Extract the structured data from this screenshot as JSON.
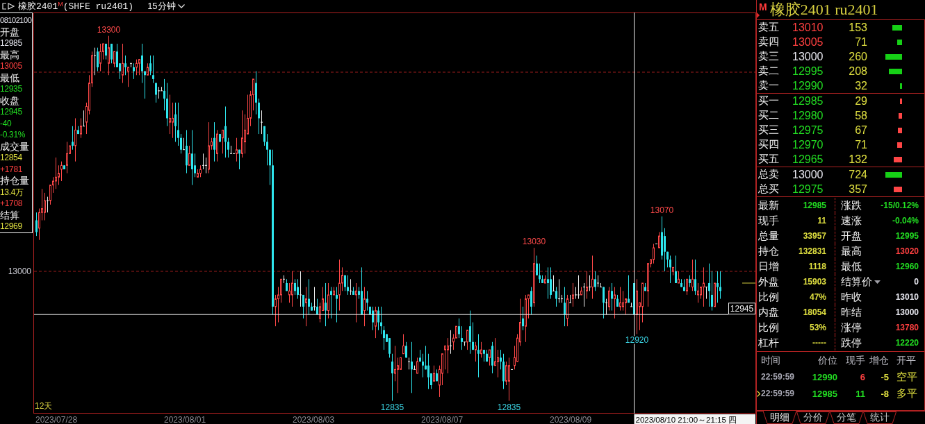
{
  "title_bar": {
    "title": "橡胶2401$^{M}$(SHFE ru2401)",
    "period": "15分钟"
  },
  "info_panel": {
    "time": "08102100",
    "fields": [
      {
        "label": "开盘",
        "values": [
          {
            "text": "12985",
            "color": "#e8e8f0"
          }
        ]
      },
      {
        "label": "最高",
        "values": [
          {
            "text": "13005",
            "color": "#ff4040"
          }
        ]
      },
      {
        "label": "最低",
        "values": [
          {
            "text": "12935",
            "color": "#22dd22"
          }
        ]
      },
      {
        "label": "收盘",
        "values": [
          {
            "text": "12945",
            "color": "#22dd22"
          },
          {
            "text": "-40",
            "color": "#22dd22"
          },
          {
            "text": "-0.31%",
            "color": "#22dd22"
          }
        ]
      },
      {
        "label": "成交量",
        "values": [
          {
            "text": "12854",
            "color": "#e0e040"
          },
          {
            "text": "+1781",
            "color": "#ff4040"
          }
        ]
      },
      {
        "label": "持仓量",
        "values": [
          {
            "text": "13.4万",
            "color": "#e0e040"
          },
          {
            "text": "+1708",
            "color": "#ff4040"
          }
        ]
      },
      {
        "label": "结算",
        "values": [
          {
            "text": "12969",
            "color": "#e0e040"
          }
        ]
      }
    ]
  },
  "chart": {
    "y_axis_label": "13000",
    "annotations": [
      {
        "text": "13300",
        "kind": "high"
      },
      {
        "text": "12835",
        "kind": "low"
      },
      {
        "text": "12835",
        "kind": "low"
      },
      {
        "text": "13030",
        "kind": "high"
      },
      {
        "text": "12920",
        "kind": "low"
      },
      {
        "text": "13070",
        "kind": "high"
      }
    ],
    "crosshair_price": "12945",
    "range_label": "12天",
    "x_axis_labels": [
      "2023/07/28",
      "2023/08/01",
      "2023/08/03",
      "2023/08/07",
      "2023/08/09"
    ],
    "crosshair_time": "2023/08/10 21:00～21:15 四"
  },
  "quote_header": {
    "badge": "M",
    "title": "橡胶2401 ru2401"
  },
  "order_book": {
    "asks": [
      {
        "label": "卖五",
        "price": {
          "text": "13010",
          "color": "#ff4040"
        },
        "quantity": "153",
        "color": "#16d016"
      },
      {
        "label": "卖四",
        "price": {
          "text": "13005",
          "color": "#ff4040"
        },
        "quantity": "71",
        "color": "#16d016"
      },
      {
        "label": "卖三",
        "price": {
          "text": "13000",
          "color": "#e8e8f0"
        },
        "quantity": "260",
        "color": "#16d016"
      },
      {
        "label": "卖二",
        "price": {
          "text": "12995",
          "color": "#22dd22"
        },
        "quantity": "208",
        "color": "#16d016"
      },
      {
        "label": "卖一",
        "price": {
          "text": "12990",
          "color": "#22dd22"
        },
        "quantity": "32",
        "color": "#16d016"
      }
    ],
    "bids": [
      {
        "label": "买一",
        "price": {
          "text": "12985",
          "color": "#22dd22"
        },
        "quantity": "29",
        "color": "#ff4646"
      },
      {
        "label": "买二",
        "price": {
          "text": "12980",
          "color": "#22dd22"
        },
        "quantity": "58",
        "color": "#ff4646"
      },
      {
        "label": "买三",
        "price": {
          "text": "12975",
          "color": "#22dd22"
        },
        "quantity": "67",
        "color": "#ff4646"
      },
      {
        "label": "买四",
        "price": {
          "text": "12970",
          "color": "#22dd22"
        },
        "quantity": "71",
        "color": "#ff4646"
      },
      {
        "label": "买五",
        "price": {
          "text": "12965",
          "color": "#22dd22"
        },
        "quantity": "132",
        "color": "#ff4646"
      }
    ],
    "totals": [
      {
        "label": "总卖",
        "price": {
          "text": "13000",
          "color": "#e8e8f0"
        },
        "quantity": "724",
        "color": "#16d016"
      },
      {
        "label": "总买",
        "price": {
          "text": "12975",
          "color": "#22dd22"
        },
        "quantity": "357",
        "color": "#ff4646"
      }
    ]
  },
  "quote_stats": [
    {
      "label": "最新",
      "value": "12985",
      "color": "#22dd22",
      "kind": "field"
    },
    {
      "label": "涨跌",
      "value": "-15/0.12%",
      "color": "#22dd22",
      "kind": "field"
    },
    {
      "label": "现手",
      "value": "11",
      "color": "#e0e040",
      "kind": "field"
    },
    {
      "label": "速涨",
      "value": "-0.04%",
      "color": "#22dd22",
      "kind": "field"
    },
    {
      "label": "总量",
      "value": "33957",
      "color": "#e0e040",
      "kind": "field"
    },
    {
      "label": "开盘",
      "value": "12995",
      "color": "#22dd22",
      "kind": "field"
    },
    {
      "label": "持仓",
      "value": "132831",
      "color": "#e0e040",
      "kind": "field"
    },
    {
      "label": "最高",
      "value": "13020",
      "color": "#ff4040",
      "kind": "field"
    },
    {
      "label": "日增",
      "value": "1118",
      "color": "#e0e040",
      "kind": "field"
    },
    {
      "label": "最低",
      "value": "12960",
      "color": "#22dd22",
      "kind": "field"
    },
    {
      "label": "外盘",
      "value": "15903",
      "color": "#e0e040",
      "kind": "field"
    },
    {
      "label": "结算价",
      "value": "0",
      "color": "#e8e8f0",
      "kind": "dropdown"
    },
    {
      "label": "比例",
      "value": "47%",
      "color": "#e0e040",
      "kind": "field"
    },
    {
      "label": "昨收",
      "value": "13010",
      "color": "#e8e8f0",
      "kind": "field"
    },
    {
      "label": "内盘",
      "value": "18054",
      "color": "#e0e040",
      "kind": "field"
    },
    {
      "label": "昨结",
      "value": "13000",
      "color": "#e8e8f0",
      "kind": "field"
    },
    {
      "label": "比例",
      "value": "53%",
      "color": "#e0e040",
      "kind": "field"
    },
    {
      "label": "涨停",
      "value": "13780",
      "color": "#ff4040",
      "kind": "field"
    },
    {
      "label": "杠杆",
      "value": "-----",
      "color": "#e0e040",
      "kind": "field"
    },
    {
      "label": "跌停",
      "value": "12220",
      "color": "#22dd22",
      "kind": "field"
    }
  ],
  "trades": {
    "columns": [
      "时间",
      "价位",
      "现手",
      "增仓",
      "开平"
    ],
    "rows": [
      {
        "time": "22:59:59",
        "price": "12990",
        "volume": {
          "text": "6",
          "color": "#ff4040"
        },
        "oi_change": "-5",
        "action": "空平",
        "selected": false
      },
      {
        "time": "22:59:59",
        "price": "12985",
        "volume": {
          "text": "11",
          "color": "#22dd22"
        },
        "oi_change": "-8",
        "action": "多平",
        "selected": true
      }
    ]
  },
  "tabs": [
    {
      "label": "明细",
      "selected": true
    },
    {
      "label": "分价",
      "selected": false
    },
    {
      "label": "分笔",
      "selected": false
    },
    {
      "label": "统计",
      "selected": false
    }
  ]
}
